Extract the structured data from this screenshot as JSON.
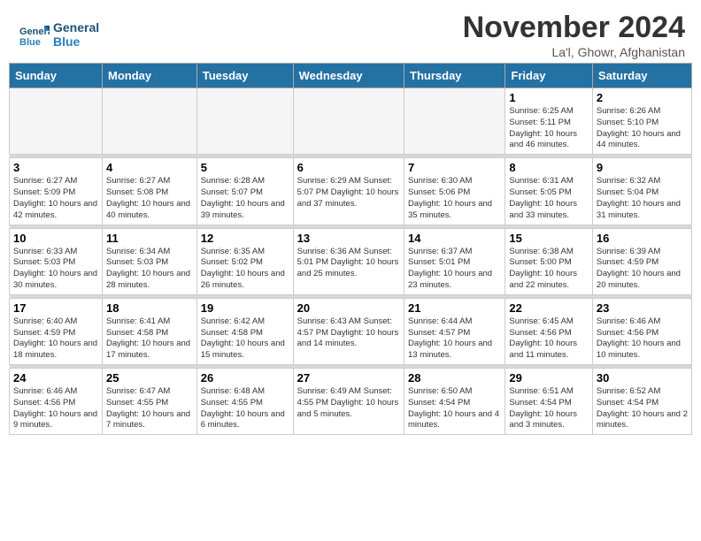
{
  "header": {
    "logo_line1": "General",
    "logo_line2": "Blue",
    "month_title": "November 2024",
    "location": "La'l, Ghowr, Afghanistan"
  },
  "weekdays": [
    "Sunday",
    "Monday",
    "Tuesday",
    "Wednesday",
    "Thursday",
    "Friday",
    "Saturday"
  ],
  "weeks": [
    [
      {
        "day": "",
        "info": ""
      },
      {
        "day": "",
        "info": ""
      },
      {
        "day": "",
        "info": ""
      },
      {
        "day": "",
        "info": ""
      },
      {
        "day": "",
        "info": ""
      },
      {
        "day": "1",
        "info": "Sunrise: 6:25 AM\nSunset: 5:11 PM\nDaylight: 10 hours\nand 46 minutes."
      },
      {
        "day": "2",
        "info": "Sunrise: 6:26 AM\nSunset: 5:10 PM\nDaylight: 10 hours\nand 44 minutes."
      }
    ],
    [
      {
        "day": "3",
        "info": "Sunrise: 6:27 AM\nSunset: 5:09 PM\nDaylight: 10 hours\nand 42 minutes."
      },
      {
        "day": "4",
        "info": "Sunrise: 6:27 AM\nSunset: 5:08 PM\nDaylight: 10 hours\nand 40 minutes."
      },
      {
        "day": "5",
        "info": "Sunrise: 6:28 AM\nSunset: 5:07 PM\nDaylight: 10 hours\nand 39 minutes."
      },
      {
        "day": "6",
        "info": "Sunrise: 6:29 AM\nSunset: 5:07 PM\nDaylight: 10 hours\nand 37 minutes."
      },
      {
        "day": "7",
        "info": "Sunrise: 6:30 AM\nSunset: 5:06 PM\nDaylight: 10 hours\nand 35 minutes."
      },
      {
        "day": "8",
        "info": "Sunrise: 6:31 AM\nSunset: 5:05 PM\nDaylight: 10 hours\nand 33 minutes."
      },
      {
        "day": "9",
        "info": "Sunrise: 6:32 AM\nSunset: 5:04 PM\nDaylight: 10 hours\nand 31 minutes."
      }
    ],
    [
      {
        "day": "10",
        "info": "Sunrise: 6:33 AM\nSunset: 5:03 PM\nDaylight: 10 hours\nand 30 minutes."
      },
      {
        "day": "11",
        "info": "Sunrise: 6:34 AM\nSunset: 5:03 PM\nDaylight: 10 hours\nand 28 minutes."
      },
      {
        "day": "12",
        "info": "Sunrise: 6:35 AM\nSunset: 5:02 PM\nDaylight: 10 hours\nand 26 minutes."
      },
      {
        "day": "13",
        "info": "Sunrise: 6:36 AM\nSunset: 5:01 PM\nDaylight: 10 hours\nand 25 minutes."
      },
      {
        "day": "14",
        "info": "Sunrise: 6:37 AM\nSunset: 5:01 PM\nDaylight: 10 hours\nand 23 minutes."
      },
      {
        "day": "15",
        "info": "Sunrise: 6:38 AM\nSunset: 5:00 PM\nDaylight: 10 hours\nand 22 minutes."
      },
      {
        "day": "16",
        "info": "Sunrise: 6:39 AM\nSunset: 4:59 PM\nDaylight: 10 hours\nand 20 minutes."
      }
    ],
    [
      {
        "day": "17",
        "info": "Sunrise: 6:40 AM\nSunset: 4:59 PM\nDaylight: 10 hours\nand 18 minutes."
      },
      {
        "day": "18",
        "info": "Sunrise: 6:41 AM\nSunset: 4:58 PM\nDaylight: 10 hours\nand 17 minutes."
      },
      {
        "day": "19",
        "info": "Sunrise: 6:42 AM\nSunset: 4:58 PM\nDaylight: 10 hours\nand 15 minutes."
      },
      {
        "day": "20",
        "info": "Sunrise: 6:43 AM\nSunset: 4:57 PM\nDaylight: 10 hours\nand 14 minutes."
      },
      {
        "day": "21",
        "info": "Sunrise: 6:44 AM\nSunset: 4:57 PM\nDaylight: 10 hours\nand 13 minutes."
      },
      {
        "day": "22",
        "info": "Sunrise: 6:45 AM\nSunset: 4:56 PM\nDaylight: 10 hours\nand 11 minutes."
      },
      {
        "day": "23",
        "info": "Sunrise: 6:46 AM\nSunset: 4:56 PM\nDaylight: 10 hours\nand 10 minutes."
      }
    ],
    [
      {
        "day": "24",
        "info": "Sunrise: 6:46 AM\nSunset: 4:56 PM\nDaylight: 10 hours\nand 9 minutes."
      },
      {
        "day": "25",
        "info": "Sunrise: 6:47 AM\nSunset: 4:55 PM\nDaylight: 10 hours\nand 7 minutes."
      },
      {
        "day": "26",
        "info": "Sunrise: 6:48 AM\nSunset: 4:55 PM\nDaylight: 10 hours\nand 6 minutes."
      },
      {
        "day": "27",
        "info": "Sunrise: 6:49 AM\nSunset: 4:55 PM\nDaylight: 10 hours\nand 5 minutes."
      },
      {
        "day": "28",
        "info": "Sunrise: 6:50 AM\nSunset: 4:54 PM\nDaylight: 10 hours\nand 4 minutes."
      },
      {
        "day": "29",
        "info": "Sunrise: 6:51 AM\nSunset: 4:54 PM\nDaylight: 10 hours\nand 3 minutes."
      },
      {
        "day": "30",
        "info": "Sunrise: 6:52 AM\nSunset: 4:54 PM\nDaylight: 10 hours\nand 2 minutes."
      }
    ]
  ]
}
